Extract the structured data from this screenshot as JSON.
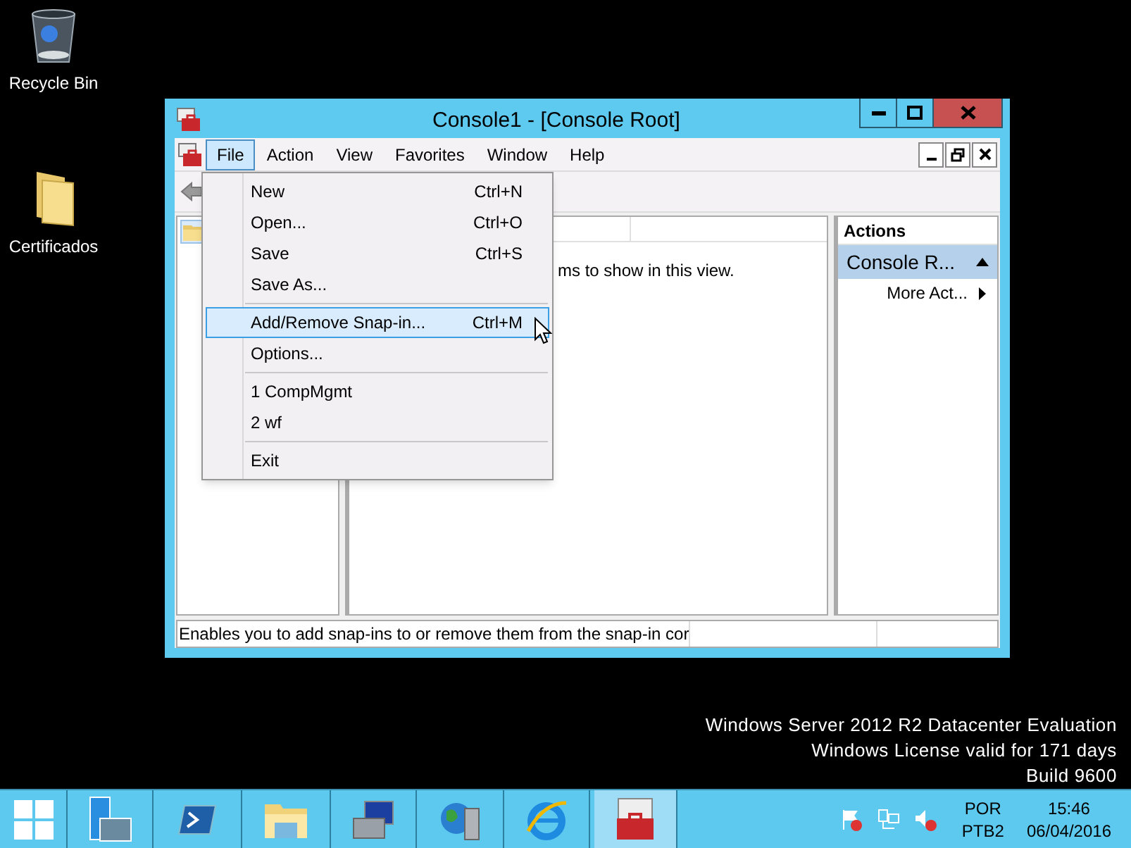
{
  "desktop_icons": [
    {
      "label": "Recycle Bin",
      "kind": "recycle"
    },
    {
      "label": "Certificados",
      "kind": "folder"
    }
  ],
  "window": {
    "title": "Console1 - [Console Root]",
    "menu": [
      {
        "label": "File",
        "selected": true
      },
      {
        "label": "Action",
        "selected": false
      },
      {
        "label": "View",
        "selected": false
      },
      {
        "label": "Favorites",
        "selected": false
      },
      {
        "label": "Window",
        "selected": false
      },
      {
        "label": "Help",
        "selected": false
      }
    ],
    "center_pane": {
      "message": "ms to show in this view."
    },
    "actions_pane": {
      "title": "Actions",
      "section": "Console R...",
      "expanded": true,
      "items": [
        {
          "label": "More Act..."
        }
      ]
    },
    "status_bar": "Enables you to add snap-ins to or remove them from the snap-in cor"
  },
  "file_menu": {
    "groups": [
      {
        "items": [
          {
            "label": "New",
            "shortcut": "Ctrl+N",
            "selected": false
          },
          {
            "label": "Open...",
            "shortcut": "Ctrl+O",
            "selected": false
          },
          {
            "label": "Save",
            "shortcut": "Ctrl+S",
            "selected": false
          },
          {
            "label": "Save As...",
            "selected": false
          }
        ]
      },
      {
        "items": [
          {
            "label": "Add/Remove Snap-in...",
            "shortcut": "Ctrl+M",
            "selected": true
          },
          {
            "label": "Options...",
            "selected": false
          }
        ]
      },
      {
        "items": [
          {
            "label": "1 CompMgmt",
            "selected": false
          },
          {
            "label": "2 wf",
            "selected": false
          }
        ]
      },
      {
        "items": [
          {
            "label": "Exit",
            "selected": false
          }
        ]
      }
    ]
  },
  "desktop_text": [
    "Windows Server 2012 R2 Datacenter Evaluation",
    "Windows License valid for 171 days",
    "Build 9600"
  ],
  "taskbar": {
    "apps": [
      {
        "kind": "server-manager",
        "selected": false
      },
      {
        "kind": "powershell",
        "selected": false
      },
      {
        "kind": "explorer",
        "selected": false
      },
      {
        "kind": "tools",
        "selected": false
      },
      {
        "kind": "network-server",
        "selected": false
      },
      {
        "kind": "browser",
        "selected": false
      },
      {
        "kind": "toolbox",
        "selected": true
      }
    ],
    "language": "POR",
    "keyboard": "PTB2",
    "time": "15:46",
    "date": "06/04/2016"
  }
}
